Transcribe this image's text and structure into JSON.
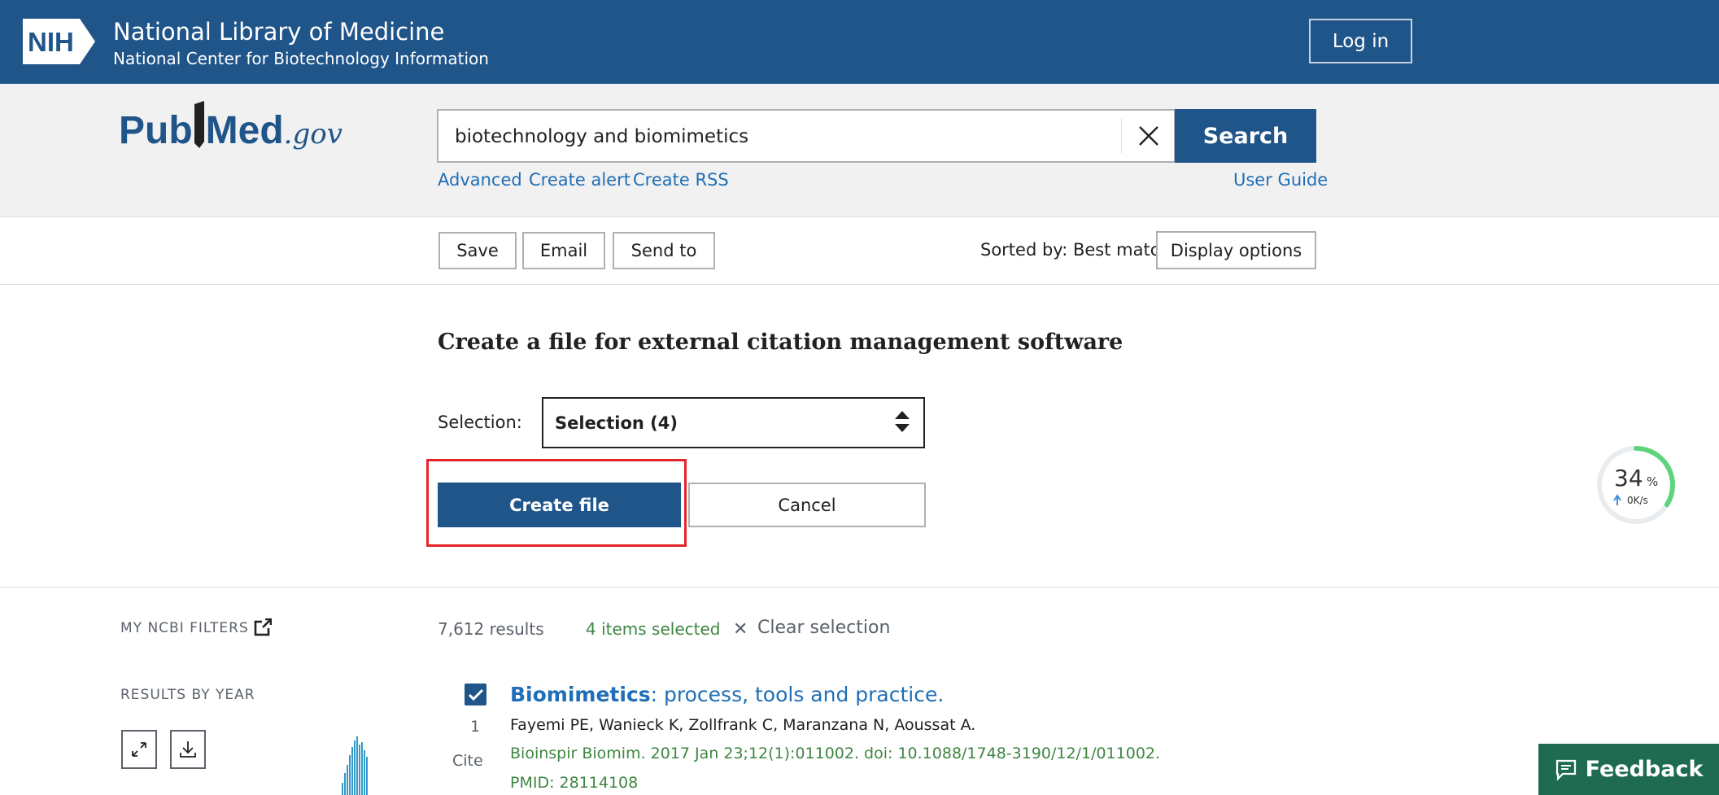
{
  "header": {
    "nih_logo_text": "NIH",
    "org_title": "National Library of Medicine",
    "org_subtitle": "National Center for Biotechnology Information",
    "login_label": "Log in"
  },
  "search": {
    "logo_part1": "Pub",
    "logo_part2": "Med",
    "logo_suffix": ".gov",
    "query": "biotechnology and biomimetics",
    "button_label": "Search",
    "links": {
      "advanced": "Advanced",
      "create_alert": "Create alert",
      "create_rss": "Create RSS",
      "user_guide": "User Guide"
    }
  },
  "actions": {
    "save": "Save",
    "email": "Email",
    "send_to": "Send to",
    "sorted_by": "Sorted by: Best match",
    "display_options": "Display options"
  },
  "citation_panel": {
    "title": "Create a file for external citation management software",
    "selection_label": "Selection:",
    "selection_value": "Selection (4)",
    "create_file": "Create file",
    "cancel": "Cancel"
  },
  "speed_widget": {
    "percent": "34",
    "percent_sign": "%",
    "rate": "0K/s",
    "progress": 0.34
  },
  "sidebar": {
    "my_ncbi_filters": "MY NCBI FILTERS",
    "results_by_year": "RESULTS BY YEAR"
  },
  "results": {
    "count": "7,612 results",
    "selected": "4 items selected",
    "clear_selection": "Clear selection",
    "items": [
      {
        "number": "1",
        "cite": "Cite",
        "title_highlight": "Biomimetics",
        "title_rest": ": process, tools and practice.",
        "authors": "Fayemi PE, Wanieck K, Zollfrank C, Maranzana N, Aoussat A.",
        "journal": "Bioinspir Biomim. 2017 Jan 23;12(1):011002. doi: 10.1088/1748-3190/12/1/011002.",
        "pmid": "PMID: 28114108"
      }
    ]
  },
  "feedback_label": "Feedback",
  "colors": {
    "brand": "#20558a",
    "link": "#1f6eb6",
    "green": "#3e8642",
    "highlight": "#e4242b",
    "feedback": "#1e6b52"
  }
}
